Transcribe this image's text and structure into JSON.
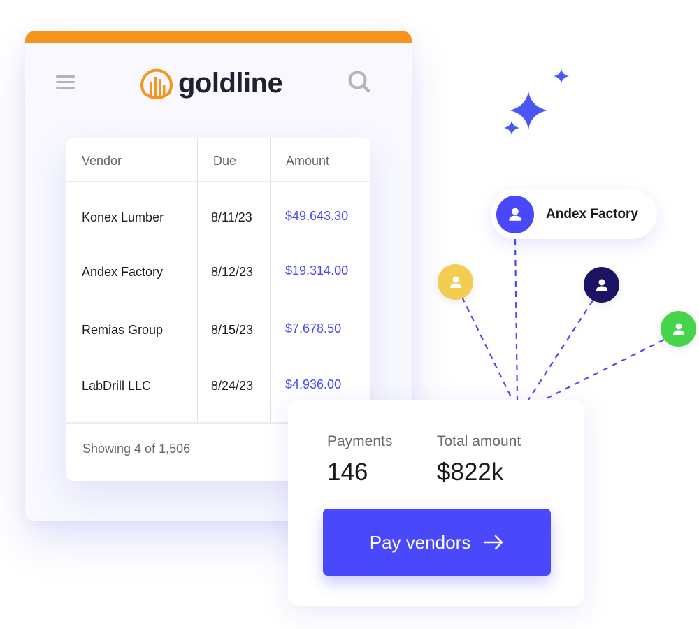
{
  "app": {
    "brand": "goldline",
    "icons": {
      "menu": "hamburger-menu-icon",
      "search": "search-icon",
      "logo": "goldline-logo-icon"
    }
  },
  "colors": {
    "brand_orange": "#f7941d",
    "accent_blue": "#4a48fb",
    "amount_blue": "#4a48f5",
    "avatar_yellow": "#f2cd4f",
    "avatar_navy": "#1b1464",
    "avatar_green": "#46d54a",
    "avatar_blue": "#4a48fb"
  },
  "table": {
    "columns": [
      "Vendor",
      "Due",
      "Amount"
    ],
    "rows": [
      {
        "vendor": "Konex Lumber",
        "due": "8/11/23",
        "amount": "$49,643.30"
      },
      {
        "vendor": "Andex Factory",
        "due": "8/12/23",
        "amount": "$19,314.00"
      },
      {
        "vendor": "Remias Group",
        "due": "8/15/23",
        "amount": "$7,678.50"
      },
      {
        "vendor": "LabDrill LLC",
        "due": "8/24/23",
        "amount": "$4,936.00"
      }
    ],
    "footer": "Showing 4 of 1,506"
  },
  "summary": {
    "payments_label": "Payments",
    "payments_value": "146",
    "total_label": "Total amount",
    "total_value": "$822k",
    "button_label": "Pay vendors",
    "button_icon": "arrow-right-icon"
  },
  "network": {
    "highlighted_vendor": "Andex Factory",
    "avatars": [
      "user-icon",
      "user-icon",
      "user-icon",
      "user-icon"
    ]
  }
}
